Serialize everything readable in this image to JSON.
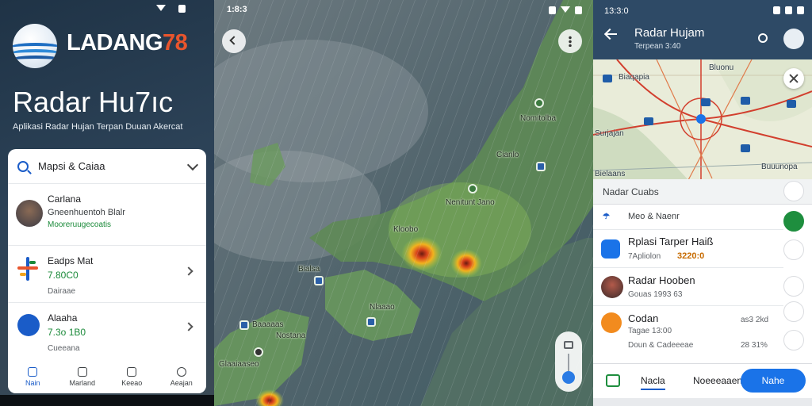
{
  "panel1": {
    "brand": {
      "name": "LADANG",
      "num": "78"
    },
    "hero_title": "Radar Hu7ıc",
    "hero_sub": "Aplikasi Radar Hujan Terpan Duuan Akercat",
    "search_label": "Mapsi & Caiaa",
    "items": [
      {
        "title": "Carlana",
        "sub": "Gneenhuentoh Blalr",
        "meta": "Mooreruugecoatis"
      },
      {
        "title": "Eadps Mat",
        "value": "7.80C0",
        "meta": "Dairaae"
      },
      {
        "title": "Alaaha",
        "value": "7.3o 1B0",
        "meta": "Cueeana"
      }
    ],
    "nav": [
      "Nain",
      "Marland",
      "Keeao",
      "Aeajan"
    ]
  },
  "panel2": {
    "time": "1:8:3",
    "labels": [
      "Nomitolba",
      "Cianlo",
      "Nenitunt Jano",
      "Kloobo",
      "Bialsa",
      "Nlaaao",
      "Baaaaas",
      "Nostana",
      "Glaaiaaseo"
    ]
  },
  "panel3": {
    "time": "13:3:0",
    "title": "Radar Hujam",
    "subtitle": "Terpean 3:40",
    "map_labels": [
      "Biaqapia",
      "Bluonu",
      "Surjajan",
      "Bielaans",
      "Buuunopa"
    ],
    "sheet_header": "Nadar Cuabs",
    "rows": [
      {
        "title": "Meo & Naenr",
        "sub": ""
      },
      {
        "title": "Rplasi Tarper Haiß",
        "sub": "7Apliolon",
        "orange": "3220:0"
      },
      {
        "title": "Radar Hooben",
        "sub": "Gouas 1993 63"
      },
      {
        "title": "Codan",
        "sub": "Tagae 13:00",
        "meta": "Doun & Cadeeeae",
        "tag": "as3 2kd",
        "pct": "28 31%"
      }
    ],
    "tabs": [
      "Nacla",
      "Noeeeaaen"
    ],
    "pill": "Nahe"
  }
}
